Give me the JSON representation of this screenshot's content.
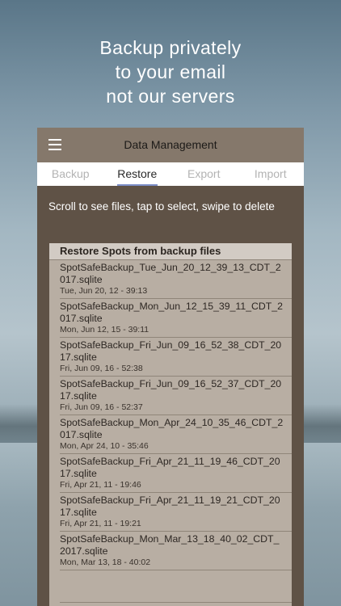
{
  "tagline": [
    "Backup privately",
    "to your email",
    "not our servers"
  ],
  "navbar": {
    "title": "Data Management",
    "menu_icon": "hamburger-menu-icon"
  },
  "tabs": [
    {
      "label": "Backup",
      "active": false
    },
    {
      "label": "Restore",
      "active": true
    },
    {
      "label": "Export",
      "active": false
    },
    {
      "label": "Import",
      "active": false
    }
  ],
  "instruction": "Scroll to see files, tap to select, swipe to delete",
  "panel": {
    "header": "Restore Spots from backup files",
    "files": [
      {
        "name": "SpotSafeBackup_Tue_Jun_20_12_39_13_CDT_2017.sqlite",
        "date": "Tue, Jun 20, 12 - 39:13"
      },
      {
        "name": "SpotSafeBackup_Mon_Jun_12_15_39_11_CDT_2017.sqlite",
        "date": "Mon, Jun 12, 15 - 39:11"
      },
      {
        "name": "SpotSafeBackup_Fri_Jun_09_16_52_38_CDT_2017.sqlite",
        "date": "Fri, Jun 09, 16 - 52:38"
      },
      {
        "name": "SpotSafeBackup_Fri_Jun_09_16_52_37_CDT_2017.sqlite",
        "date": "Fri, Jun 09, 16 - 52:37"
      },
      {
        "name": "SpotSafeBackup_Mon_Apr_24_10_35_46_CDT_2017.sqlite",
        "date": "Mon, Apr 24, 10 - 35:46"
      },
      {
        "name": "SpotSafeBackup_Fri_Apr_21_11_19_46_CDT_2017.sqlite",
        "date": "Fri, Apr 21, 11 - 19:46"
      },
      {
        "name": "SpotSafeBackup_Fri_Apr_21_11_19_21_CDT_2017.sqlite",
        "date": "Fri, Apr 21, 11 - 19:21"
      },
      {
        "name": "SpotSafeBackup_Mon_Mar_13_18_40_02_CDT_2017.sqlite",
        "date": "Mon, Mar 13, 18 - 40:02"
      }
    ]
  },
  "colors": {
    "navbar": "#85786b",
    "screen_bg": "#5f5246",
    "panel_bg": "#b8aea3",
    "tab_active_underline": "#7d8fc8"
  }
}
